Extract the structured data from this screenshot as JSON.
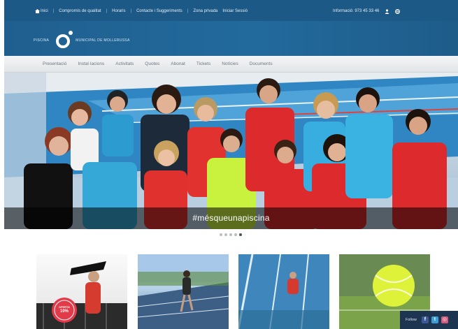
{
  "topbar": {
    "links": [
      {
        "label": "Inici"
      },
      {
        "label": "Compromís de qualitat"
      },
      {
        "label": "Horaris"
      },
      {
        "label": "Contacte i Suggeriments"
      },
      {
        "label": "Zona privada"
      },
      {
        "label": "Iniciar Sessió"
      }
    ],
    "phone": "Informació: 973 45 33 46",
    "icons": [
      "home-icon",
      "user-icon",
      "globe-icon"
    ]
  },
  "logo": {
    "line1": "PISCINA",
    "line2": "MUNICIPAL DE MOLLERUSSA"
  },
  "nav": {
    "items": [
      {
        "label": "Presentació"
      },
      {
        "label": "Instal·lacions"
      },
      {
        "label": "Activitats"
      },
      {
        "label": "Quotes"
      },
      {
        "label": "Abonat"
      },
      {
        "label": "Tickets"
      },
      {
        "label": "Notícies"
      },
      {
        "label": "Documents"
      }
    ]
  },
  "hero": {
    "caption": "#mésqueunapiscina",
    "slides_count": 5,
    "active_slide": 5
  },
  "cards": [
    {
      "overlay_text": "OFERTA",
      "badge_text": "10%"
    },
    {
      "overlay_text": ""
    },
    {
      "overlay_text": ""
    },
    {
      "overlay_text": ""
    }
  ],
  "follow": {
    "label": "Follow",
    "networks": [
      {
        "icon": "facebook-icon",
        "glyph": "f",
        "color": "#3b5998"
      },
      {
        "icon": "twitter-icon",
        "glyph": "t",
        "color": "#3b9edb"
      },
      {
        "icon": "instagram-icon",
        "glyph": "◎",
        "color": "#d35a7a"
      }
    ]
  },
  "colors": {
    "header_blue": "#226a9c",
    "nav_bg": "#e6e9ec",
    "caption_bg": "#000000",
    "follow_bg": "#1d3550"
  }
}
